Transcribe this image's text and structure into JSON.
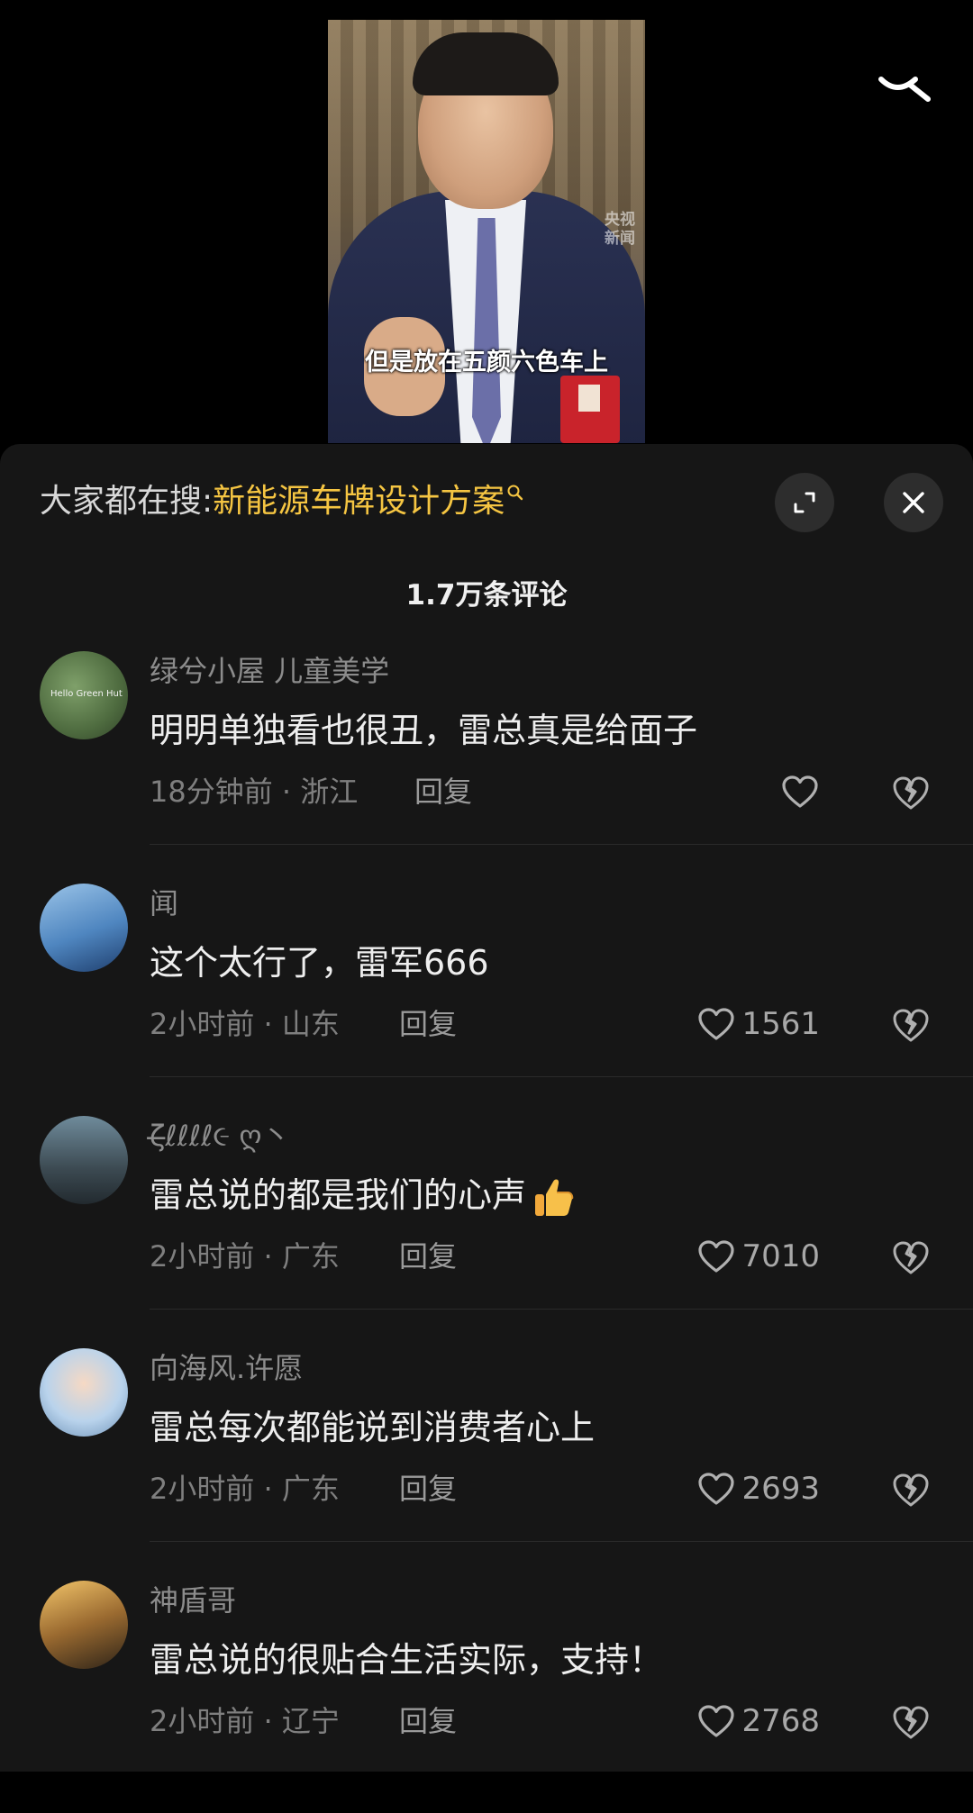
{
  "video": {
    "subtitle": "但是放在五颜六色车上",
    "watermark_line1": "央视",
    "watermark_line2": "新闻"
  },
  "search_bar": {
    "prefix": "大家都在搜:",
    "term": "新能源车牌设计方案"
  },
  "comment_count": "1.7万条评论",
  "comments": [
    {
      "username": "绿兮小屋 儿童美学",
      "avatar_text": "Hello Green Hut",
      "text": "明明单独看也很丑，雷总真是给面子",
      "meta": "18分钟前 · 浙江",
      "reply": "回复",
      "likes": ""
    },
    {
      "username": "闻",
      "text": "这个太行了，雷军666",
      "meta": "2小时前 · 山东",
      "reply": "回复",
      "likes": "1561"
    },
    {
      "username": "ζ̶ℓℓℓℓ૯ ღ丶",
      "text": "雷总说的都是我们的心声",
      "meta": "2小时前 · 广东",
      "reply": "回复",
      "likes": "7010"
    },
    {
      "username": "向海风.许愿",
      "text": "雷总每次都能说到消费者心上",
      "meta": "2小时前 · 广东",
      "reply": "回复",
      "likes": "2693"
    },
    {
      "username": "神盾哥",
      "text": "雷总说的很贴合生活实际，支持！",
      "meta": "2小时前 · 辽宁",
      "reply": "回复",
      "likes": "2768"
    }
  ],
  "icons": {
    "top_right": "search-icon",
    "expand": "expand-icon",
    "close": "close-icon",
    "like": "heart-icon",
    "dislike": "broken-heart-icon",
    "emoji": "thumbs-up-emoji"
  },
  "colors": {
    "accent_search_term": "#f5c542",
    "sheet_background": "#161616"
  }
}
